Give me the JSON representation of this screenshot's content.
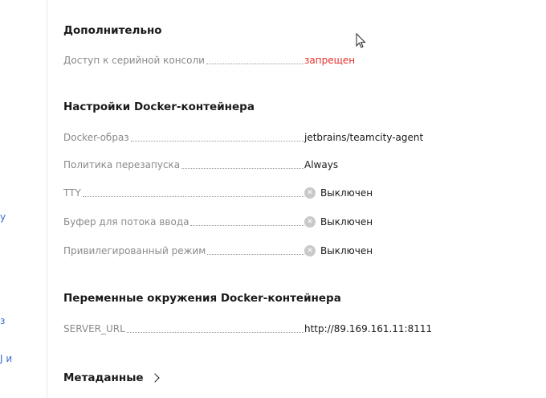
{
  "left_strip": {
    "fragments": [
      "у",
      "з",
      "J и"
    ]
  },
  "sections": {
    "additional": {
      "title": "Дополнительно",
      "rows": [
        {
          "label": "Доступ к серийной консоли",
          "value": "запрещен"
        }
      ]
    },
    "docker": {
      "title": "Настройки Docker-контейнера",
      "rows": [
        {
          "label": "Docker-образ",
          "value": "jetbrains/teamcity-agent"
        },
        {
          "label": "Политика перезапуска",
          "value": "Always"
        },
        {
          "label": "TTY",
          "value": "Выключен"
        },
        {
          "label": "Буфер для потока ввода",
          "value": "Выключен"
        },
        {
          "label": "Привилегированный режим",
          "value": "Выключен"
        }
      ]
    },
    "env": {
      "title": "Переменные окружения Docker-контейнера",
      "rows": [
        {
          "label": "SERVER_URL",
          "value": "http://89.169.161.11:8111"
        }
      ]
    }
  },
  "metadata": {
    "label": "Метаданные"
  },
  "icons": {
    "disabled": "x-circle-icon",
    "expand": "chevron-right-icon",
    "pointer": "mouse-cursor-icon"
  },
  "colors": {
    "danger": "#e5302b",
    "link": "#3a6ad1",
    "label": "#8a8a8a"
  }
}
